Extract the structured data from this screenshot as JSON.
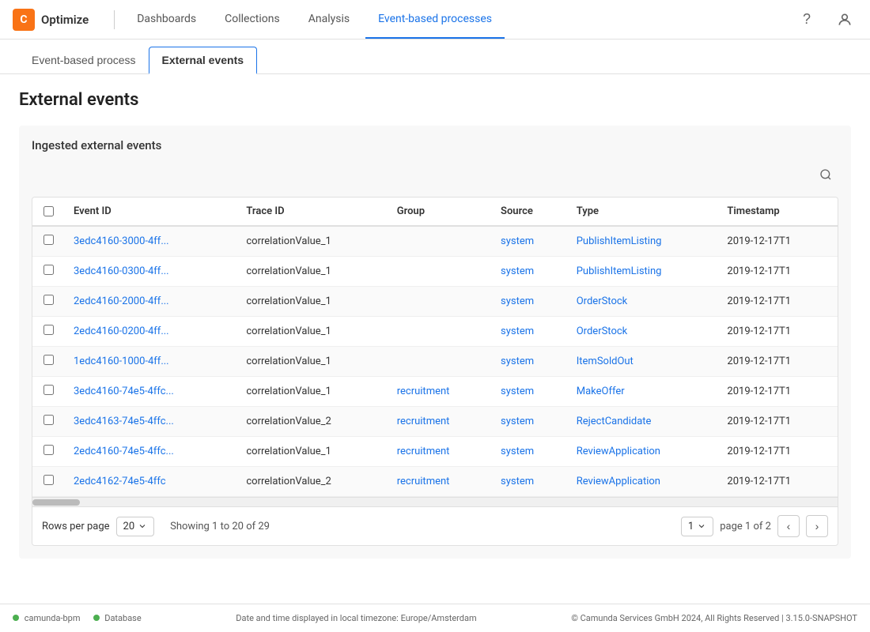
{
  "brand": {
    "icon_text": "C",
    "name": "Optimize"
  },
  "nav": {
    "items": [
      {
        "label": "Dashboards",
        "active": false
      },
      {
        "label": "Collections",
        "active": false
      },
      {
        "label": "Analysis",
        "active": false
      },
      {
        "label": "Event-based processes",
        "active": true
      }
    ]
  },
  "sub_tabs": [
    {
      "label": "Event-based process",
      "active": false
    },
    {
      "label": "External events",
      "active": true
    }
  ],
  "page": {
    "title": "External events"
  },
  "card": {
    "title": "Ingested external events",
    "search_placeholder": "Search"
  },
  "table": {
    "columns": [
      "Event ID",
      "Trace ID",
      "Group",
      "Source",
      "Type",
      "Timestamp"
    ],
    "rows": [
      {
        "event_id": "3edc4160-3000-4ff...",
        "trace_id": "correlationValue_1",
        "group": "",
        "source": "system",
        "type": "PublishItemListing",
        "timestamp": "2019-12-17T1"
      },
      {
        "event_id": "3edc4160-0300-4ff...",
        "trace_id": "correlationValue_1",
        "group": "",
        "source": "system",
        "type": "PublishItemListing",
        "timestamp": "2019-12-17T1"
      },
      {
        "event_id": "2edc4160-2000-4ff...",
        "trace_id": "correlationValue_1",
        "group": "",
        "source": "system",
        "type": "OrderStock",
        "timestamp": "2019-12-17T1"
      },
      {
        "event_id": "2edc4160-0200-4ff...",
        "trace_id": "correlationValue_1",
        "group": "",
        "source": "system",
        "type": "OrderStock",
        "timestamp": "2019-12-17T1"
      },
      {
        "event_id": "1edc4160-1000-4ff...",
        "trace_id": "correlationValue_1",
        "group": "",
        "source": "system",
        "type": "ItemSoldOut",
        "timestamp": "2019-12-17T1"
      },
      {
        "event_id": "3edc4160-74e5-4ffc...",
        "trace_id": "correlationValue_1",
        "group": "recruitment",
        "source": "system",
        "type": "MakeOffer",
        "timestamp": "2019-12-17T1"
      },
      {
        "event_id": "3edc4163-74e5-4ffc...",
        "trace_id": "correlationValue_2",
        "group": "recruitment",
        "source": "system",
        "type": "RejectCandidate",
        "timestamp": "2019-12-17T1"
      },
      {
        "event_id": "2edc4160-74e5-4ffc...",
        "trace_id": "correlationValue_1",
        "group": "recruitment",
        "source": "system",
        "type": "ReviewApplication",
        "timestamp": "2019-12-17T1"
      },
      {
        "event_id": "2edc4162-74e5-4ffc",
        "trace_id": "correlationValue_2",
        "group": "recruitment",
        "source": "system",
        "type": "ReviewApplication",
        "timestamp": "2019-12-17T1"
      }
    ]
  },
  "pagination": {
    "rows_per_page_label": "Rows per page",
    "rows_per_page_value": "20",
    "showing_text": "Showing 1 to 20 of 29",
    "current_page": "1",
    "page_of_text": "page 1 of 2",
    "total_pages": "2"
  },
  "footer": {
    "status1_label": "camunda-bpm",
    "status2_label": "Database",
    "timezone_text": "Date and time displayed in local timezone: Europe/Amsterdam",
    "copyright_text": "© Camunda Services GmbH 2024, All Rights Reserved | 3.15.0-SNAPSHOT"
  }
}
